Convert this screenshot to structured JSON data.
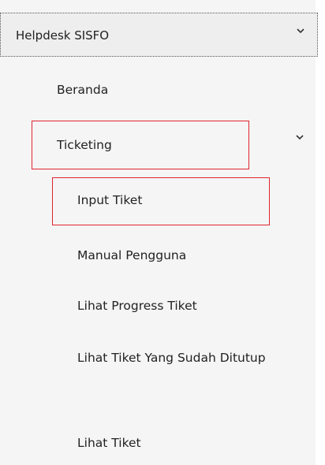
{
  "sidebar": {
    "header": {
      "label": "Helpdesk SISFO",
      "toggle_icon": "chevron-down-icon"
    },
    "items": [
      {
        "label": "Beranda"
      },
      {
        "label": "Ticketing",
        "toggle_icon": "chevron-down-icon"
      }
    ],
    "ticketing_submenu": [
      {
        "label": "Input Tiket"
      },
      {
        "label": "Manual Pengguna"
      },
      {
        "label": "Lihat Progress Tiket"
      },
      {
        "label": "Lihat Tiket Yang Sudah Ditutup"
      },
      {
        "label": "Lihat Tiket"
      }
    ]
  },
  "colors": {
    "highlight_border": "#e0242f",
    "sidebar_bg": "#f5f5f5",
    "header_bg": "#eeeeee"
  }
}
